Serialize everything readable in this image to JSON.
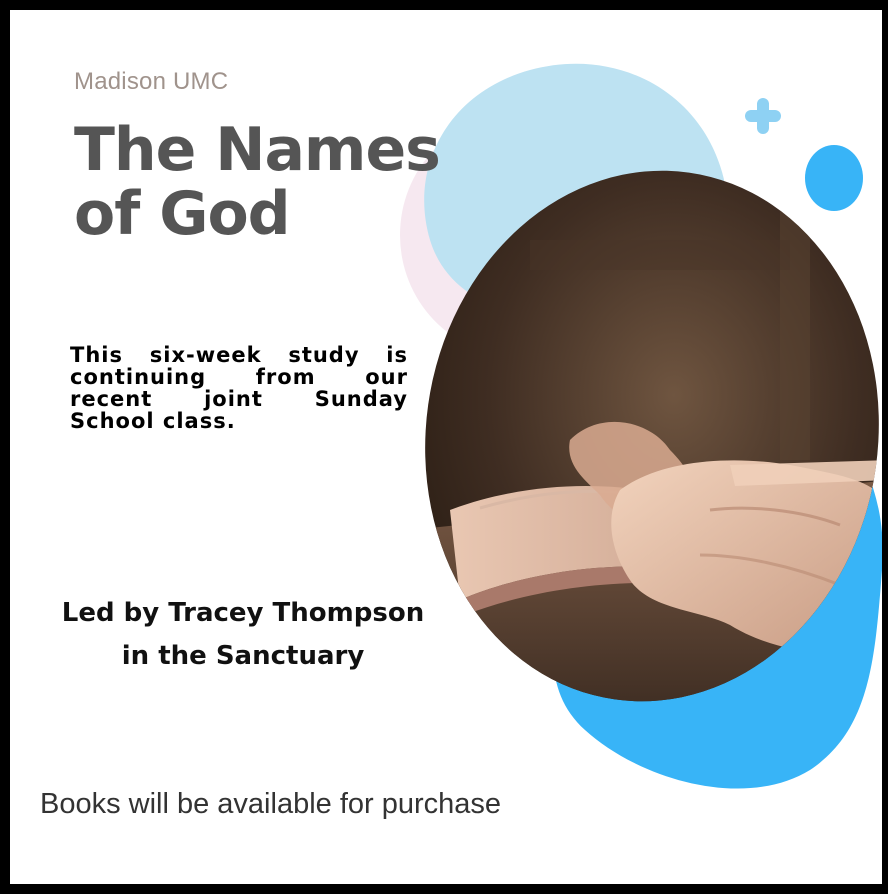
{
  "org_name": "Madison UMC",
  "title_lines": [
    "The Names",
    "of God"
  ],
  "description": "This six-week study is continuing from our recent joint Sunday School class.",
  "leader_lines": [
    "Led by Tracey Thompson",
    "in the Sanctuary"
  ],
  "footer_note": "Books will be available for purchase",
  "colors": {
    "light_blue": "#bde2f2",
    "bright_blue": "#38b4f7",
    "pale_pink": "#f6e8f0",
    "title_gray": "#555555",
    "org_gray": "#a0938c"
  },
  "icons": [
    "plus-icon",
    "blue-dot-icon"
  ],
  "image": "photo-hands-on-open-bible"
}
